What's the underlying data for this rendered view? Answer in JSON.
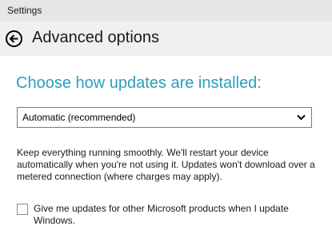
{
  "window": {
    "title": "Settings"
  },
  "header": {
    "back_icon": "back-arrow-circle-icon",
    "title": "Advanced options"
  },
  "main": {
    "heading": "Choose how updates are installed:",
    "install_dropdown": {
      "selected": "Automatic (recommended)",
      "icon": "chevron-down-icon"
    },
    "description_lines": [
      "Keep everything running smoothly. We'll restart your device",
      "automatically when you're not using it. Updates won't download over a",
      "metered connection (where charges may apply)."
    ],
    "microsoft_updates_checkbox": {
      "checked": false,
      "label": "Give me updates for other Microsoft products when I update Windows."
    }
  },
  "colors": {
    "accent_heading": "#2a9fbd",
    "titlebar_bg": "#e6e6e6",
    "header_bg": "#f0f0f0"
  }
}
